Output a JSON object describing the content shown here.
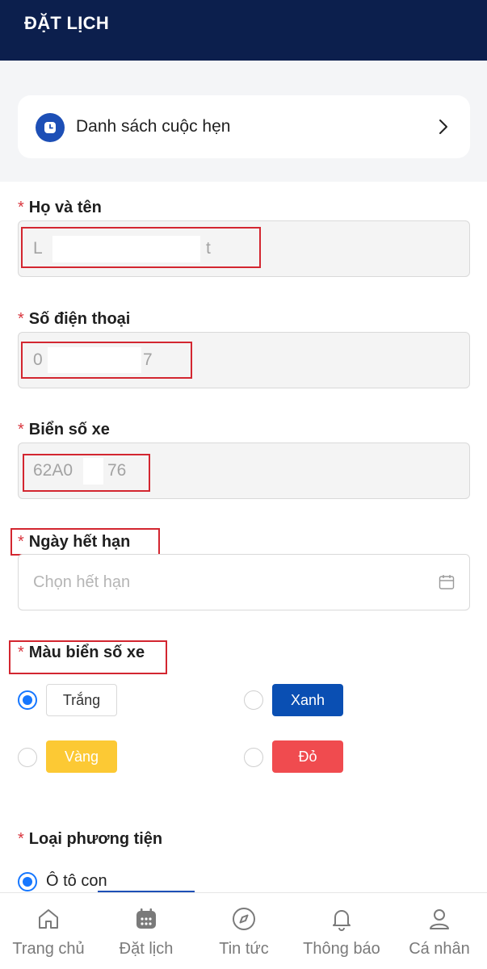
{
  "header": {
    "title": "ĐẶT LỊCH"
  },
  "appointments": {
    "label": "Danh sách cuộc hẹn"
  },
  "required_mark": "*",
  "fields": {
    "name": {
      "label": "Họ và tên",
      "value_start": "L",
      "value_end": "t"
    },
    "phone": {
      "label": "Số điện thoại",
      "value_start": "0",
      "value_end": "7"
    },
    "plate": {
      "label": "Biển số xe",
      "value_start": "62A0",
      "value_end": "76"
    },
    "expiry": {
      "label": "Ngày hết hạn",
      "placeholder": "Chọn hết hạn"
    },
    "plate_color": {
      "label": "Màu biển số xe",
      "options": [
        {
          "label": "Trắng",
          "selected": true,
          "color": "#ffffff"
        },
        {
          "label": "Xanh",
          "selected": false,
          "color": "#0a4fb3"
        },
        {
          "label": "Vàng",
          "selected": false,
          "color": "#fcc934"
        },
        {
          "label": "Đỏ",
          "selected": false,
          "color": "#f04b4f"
        }
      ]
    },
    "vehicle_type": {
      "label": "Loại phương tiện",
      "options": [
        {
          "label": "Ô tô con",
          "selected": true
        }
      ]
    }
  },
  "tabbar": {
    "active": "Đặt lịch",
    "items": [
      {
        "label": "Trang chủ",
        "icon": "home-icon"
      },
      {
        "label": "Đặt lịch",
        "icon": "calendar-icon"
      },
      {
        "label": "Tin tức",
        "icon": "compass-icon"
      },
      {
        "label": "Thông báo",
        "icon": "bell-icon"
      },
      {
        "label": "Cá nhân",
        "icon": "user-icon"
      }
    ]
  },
  "colors": {
    "header_bg": "#0c1f4d",
    "accent": "#1677ff",
    "required": "#d9363e",
    "highlight_box": "#d32630"
  }
}
